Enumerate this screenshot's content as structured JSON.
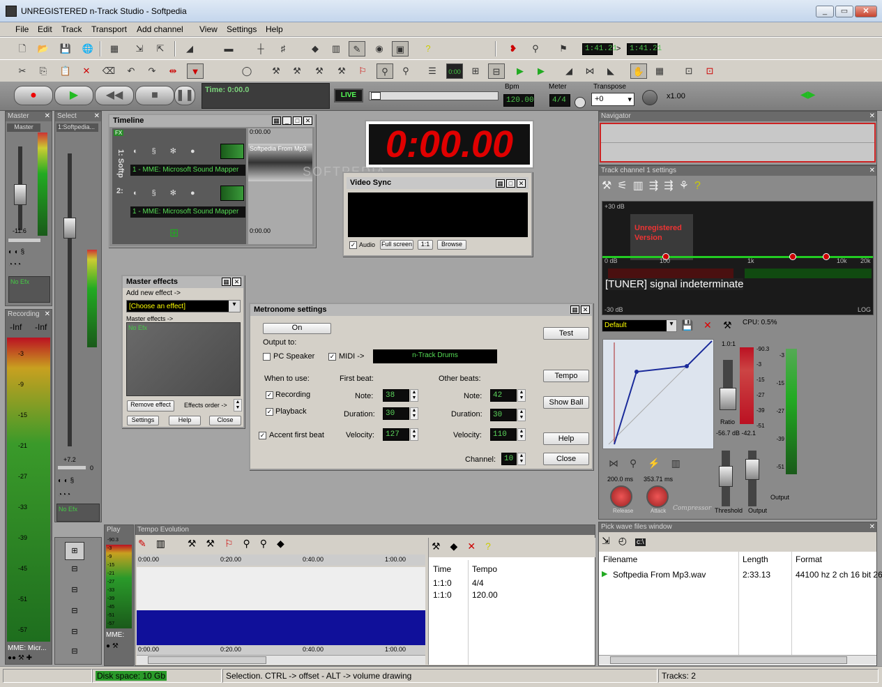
{
  "window": {
    "title": "UNREGISTERED n-Track Studio - Softpedia"
  },
  "menu": [
    "File",
    "Edit",
    "Track",
    "Transport",
    "Add channel",
    "View",
    "Settings",
    "Help"
  ],
  "toolbar": {
    "time_a": "1:41.21",
    "time_b": "1:41.21",
    "arrow": ">"
  },
  "transport": {
    "time": "Time: 0:00.0",
    "live": "LIVE",
    "bpm_label": "Bpm",
    "bpm": "120.00",
    "meter_label": "Meter",
    "meter": "4/4",
    "transpose_label": "Transpose",
    "transpose": "+0",
    "speed": "x1.00"
  },
  "master_panel": {
    "title": "Master",
    "label": "Master",
    "gain": "-11.6",
    "efx": "No Efx"
  },
  "select_panel": {
    "title": "Select",
    "label": "1:Softpedia...",
    "gain": "+7.2",
    "zero": "0",
    "efx": "No Efx"
  },
  "recording_panel": {
    "title": "Recording",
    "left": "-Inf",
    "right": "-Inf",
    "scale": [
      "-3",
      "-9",
      "-15",
      "-21",
      "-27",
      "-33",
      "-39",
      "-45",
      "-51",
      "-57"
    ],
    "device": "MME: Micr..."
  },
  "timeline": {
    "title": "Timeline",
    "fx": "FX",
    "track1": "1: Softp",
    "track2": "2:",
    "device1": "1 - MME: Microsoft Sound Mapper",
    "device2": "1 - MME: Microsoft Sound Mapper",
    "ruler_top": "0:00.00",
    "ruler_bottom": "0:00.00",
    "clip": "Softpedia From Mp3."
  },
  "big_clock": {
    "value": "0:00.00"
  },
  "watermark": "SOFTPEDIA",
  "video_sync": {
    "title": "Video Sync",
    "audio": "Audio",
    "fullscreen": "Full screen",
    "one": "1:1",
    "browse": "Browse"
  },
  "master_effects": {
    "title": "Master effects",
    "add_label": "Add new effect ->",
    "choose": "[Choose an effect]",
    "list_label": "Master effects ->",
    "no_efx": "No Efx",
    "remove": "Remove effect",
    "order": "Effects order ->",
    "settings": "Settings",
    "help": "Help",
    "close": "Close"
  },
  "metronome": {
    "title": "Metronome settings",
    "on": "On",
    "test": "Test",
    "output_to": "Output to:",
    "pc_speaker": "PC Speaker",
    "midi": "MIDI ->",
    "drums": "n-Track Drums",
    "when": "When to use:",
    "first_beat": "First beat:",
    "other_beats": "Other beats:",
    "recording": "Recording",
    "playback": "Playback",
    "accent": "Accent first beat",
    "note": "Note:",
    "duration": "Duration:",
    "velocity": "Velocity:",
    "first_note": "38",
    "first_duration": "30",
    "first_velocity": "127",
    "other_note": "42",
    "other_duration": "30",
    "other_velocity": "110",
    "channel_label": "Channel:",
    "channel": "10",
    "tempo": "Tempo",
    "show_ball": "Show Ball",
    "help": "Help",
    "close": "Close"
  },
  "navigator": {
    "title": "Navigator"
  },
  "track_settings": {
    "title": "Track channel 1 settings",
    "db_top": "+30 dB",
    "db_zero": "0 dB",
    "db_bottom": "-30 dB",
    "freq": [
      "100",
      "1k",
      "10k",
      "20k"
    ],
    "log": "LOG",
    "unregistered": "Unregistered",
    "version": "Version",
    "tuner": "[TUNER] signal indeterminate",
    "preset": "Default",
    "cpu": "CPU: 0.5%",
    "ratio_value": "1.0:1",
    "ratio": "Ratio",
    "levels": "-56.7 dB  -42.1",
    "release_ms": "200.0 ms",
    "attack_ms": "353.71 ms",
    "release": "Release",
    "attack": "Attack",
    "compressor": "Compressor",
    "threshold": "Threshold",
    "output": "Output",
    "output2": "Output",
    "meter_scale": [
      "-90.3",
      "-3",
      "-15",
      "-27",
      "-39",
      "-51"
    ],
    "right_scale": [
      "-90.3",
      "-3",
      "-15",
      "-27",
      "-39",
      "-51"
    ]
  },
  "tempo": {
    "title": "Tempo Evolution",
    "play": "Play",
    "ruler": [
      "0:00.00",
      "0:20.00",
      "0:40.00",
      "1:00.00"
    ],
    "col_time": "Time",
    "col_tempo": "Tempo",
    "rows": [
      {
        "time": "1:1:0",
        "tempo": "4/4"
      },
      {
        "time": "1:1:0",
        "tempo": "120.00"
      }
    ],
    "mme": "MME:"
  },
  "play_scale": [
    "-90.3",
    "-3",
    "-9",
    "-15",
    "-21",
    "-27",
    "-33",
    "-39",
    "-45",
    "-51",
    "-57"
  ],
  "pick_wave": {
    "title": "Pick wave files window",
    "col_filename": "Filename",
    "col_length": "Length",
    "col_format": "Format",
    "file": "Softpedia From Mp3.wav",
    "length": "2:33.13",
    "format": "44100 hz 2 ch 16 bit 26"
  },
  "status": {
    "disk": "Disk space: 10 Gb",
    "hint": "Selection. CTRL -> offset - ALT -> volume drawing",
    "tracks": "Tracks: 2"
  },
  "colors": {
    "meter_green": "#1e6e1e",
    "lcd_green": "#5cd65c",
    "clock_red": "#e00000",
    "navigator_red": "#cc2222"
  }
}
